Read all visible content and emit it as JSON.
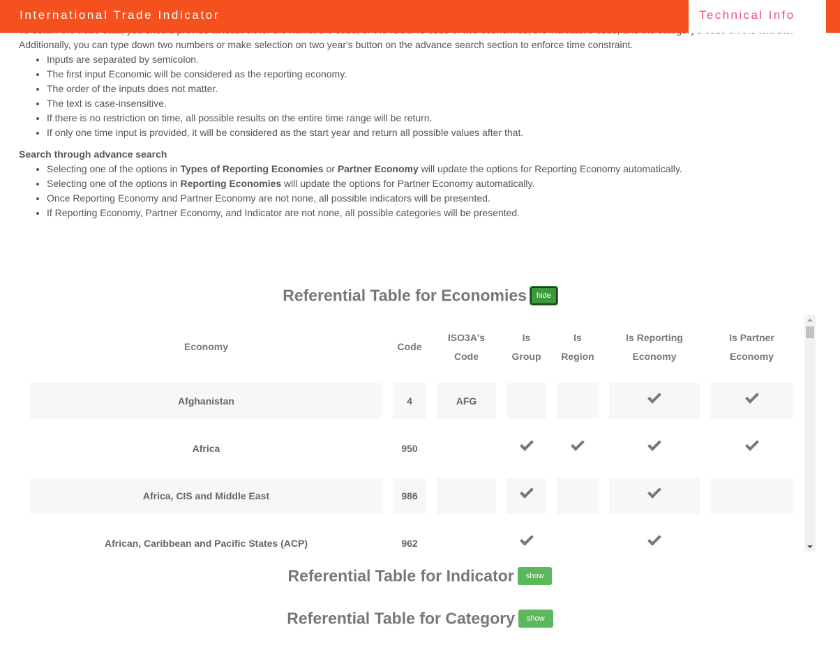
{
  "header": {
    "title": "International Trade Indicator",
    "tech_info": "Technical Info"
  },
  "intro": {
    "p1": "To obtain the trade data, you should provide at least either the name, the code, or the ISO3A's code of two economies, the indicator's code, and the category's code on the text bar. Additionally, you can type down two numbers or make selection on two year's button on the advance search section to enforce time constraint.",
    "bullets1": [
      "Inputs are separated by semicolon.",
      "The first input Economic will be considered as the reporting economy.",
      "The order of the inputs does not matter.",
      "The text is case-insensitive.",
      "If there is no restriction on time, all possible results on the entire time range will be return.",
      "If only one time input is provided, it will be considered as the start year and return all possible values after that."
    ],
    "adv_heading": "Search through advance search",
    "b1a": "Selecting one of the options in ",
    "b1b": "Types of Reporting Economies",
    "b1c": " or ",
    "b1d": "Partner Economy",
    "b1e": " will update the options for Reporting Economy automatically.",
    "b2a": "Selecting one of the options in ",
    "b2b": "Reporting Economies",
    "b2c": " will update the options for Partner Economy automatically.",
    "b3": "Once Reporting Economy and Partner Economy are not none, all possible indicators will be presented.",
    "b4": "If Reporting Economy, Partner Economy, and Indicator are not none, all possible categories will be presented."
  },
  "economies": {
    "title": "Referential Table for Economies",
    "button": "hide",
    "headers": [
      [
        "Economy"
      ],
      [
        "Code"
      ],
      [
        "ISO3A's",
        "Code"
      ],
      [
        "Is",
        "Group"
      ],
      [
        "Is",
        "Region"
      ],
      [
        "Is Reporting",
        "Economy"
      ],
      [
        "Is Partner",
        "Economy"
      ]
    ],
    "rows": [
      {
        "name": "Afghanistan",
        "code": "4",
        "iso": "AFG",
        "group": false,
        "region": false,
        "reporting": true,
        "partner": true
      },
      {
        "name": "Africa",
        "code": "950",
        "iso": "",
        "group": true,
        "region": true,
        "reporting": true,
        "partner": true
      },
      {
        "name": "Africa, CIS and Middle East",
        "code": "986",
        "iso": "",
        "group": true,
        "region": false,
        "reporting": true,
        "partner": false
      },
      {
        "name": "African, Caribbean and Pacific States (ACP)",
        "code": "962",
        "iso": "",
        "group": true,
        "region": false,
        "reporting": true,
        "partner": false
      }
    ]
  },
  "indicator": {
    "title": "Referential Table for Indicator",
    "button": "show"
  },
  "category": {
    "title": "Referential Table for Category",
    "button": "show"
  }
}
